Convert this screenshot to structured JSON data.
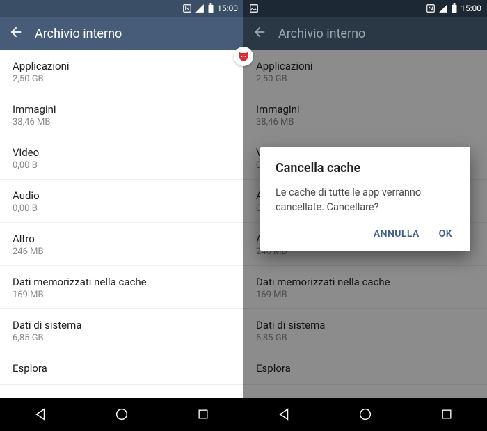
{
  "status": {
    "time": "15:00"
  },
  "appbar": {
    "title": "Archivio interno"
  },
  "items": [
    {
      "title": "Applicazioni",
      "sub": "2,50 GB"
    },
    {
      "title": "Immagini",
      "sub": "38,46 MB"
    },
    {
      "title": "Video",
      "sub": "0,00 B"
    },
    {
      "title": "Audio",
      "sub": "0,00 B"
    },
    {
      "title": "Altro",
      "sub": "246 MB"
    },
    {
      "title": "Dati memorizzati nella cache",
      "sub": "169 MB"
    },
    {
      "title": "Dati di sistema",
      "sub": "6,85 GB"
    },
    {
      "title": "Esplora",
      "sub": ""
    }
  ],
  "dialog": {
    "title": "Cancella cache",
    "message": "Le cache di tutte le app verranno cancellate. Cancellare?",
    "cancel": "ANNULLA",
    "ok": "OK"
  }
}
